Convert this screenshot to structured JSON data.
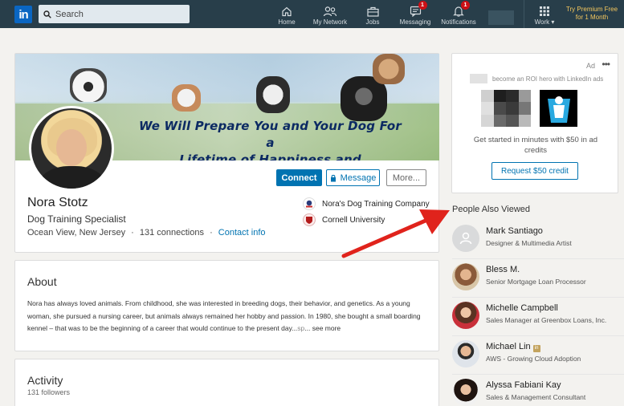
{
  "nav": {
    "logo": "in",
    "search_placeholder": "Search",
    "items": [
      {
        "label": "Home",
        "icon": "home-icon",
        "badge": ""
      },
      {
        "label": "My Network",
        "icon": "network-icon",
        "badge": ""
      },
      {
        "label": "Jobs",
        "icon": "briefcase-icon",
        "badge": ""
      },
      {
        "label": "Messaging",
        "icon": "messaging-icon",
        "badge": "1"
      },
      {
        "label": "Notifications",
        "icon": "bell-icon",
        "badge": "1"
      }
    ],
    "work_label": "Work ▾",
    "premium_line1": "Try Premium Free",
    "premium_line2": "for 1 Month"
  },
  "profile": {
    "banner_line1": "We Will Prepare You and Your Dog For a",
    "banner_line2": "Lifetime of Happiness and Understanding",
    "connect_label": "Connect",
    "message_label": "Message",
    "more_label": "More...",
    "name": "Nora Stotz",
    "headline": "Dog Training Specialist",
    "location": "Ocean View, New Jersey",
    "separator": "·",
    "connections": "131 connections",
    "contact_info": "Contact info",
    "company": "Nora's Dog Training Company",
    "school": "Cornell University"
  },
  "about": {
    "title": "About",
    "text": "Nora has always loved animals. From childhood, she was interested in breeding dogs, their behavior, and genetics. As a young woman, she pursued a nursing career, but animals always remained her hobby and passion. In 1980, she bought a small boarding kennel – that was to be the beginning of a career that would continue to the present day...",
    "faded": "sp",
    "see_more": "... see more"
  },
  "activity": {
    "title": "Activity",
    "followers": "131 followers"
  },
  "ad": {
    "label": "Ad",
    "dots": "•••",
    "line1": "become an ROI hero with LinkedIn ads",
    "text": "Get started in minutes with $50 in ad credits",
    "button": "Request $50 credit"
  },
  "people_also_viewed": {
    "title": "People Also Viewed",
    "people": [
      {
        "name": "Mark Santiago",
        "title": "Designer & Multimedia Artist",
        "premium": false
      },
      {
        "name": "Bless M.",
        "title": "Senior Mortgage Loan Processor",
        "premium": false
      },
      {
        "name": "Michelle Campbell",
        "title": "Sales Manager at Greenbox Loans, Inc.",
        "premium": false
      },
      {
        "name": "Michael Lin",
        "title": "AWS - Growing Cloud Adoption",
        "premium": true
      },
      {
        "name": "Alyssa Fabiani Kay",
        "title": "Sales & Management Consultant",
        "premium": false
      }
    ],
    "premium_badge": "in"
  },
  "colors": {
    "nav_bg": "#283e4a",
    "accent": "#0073b1",
    "badge": "#cc1016",
    "arrow": "#e0231c"
  }
}
